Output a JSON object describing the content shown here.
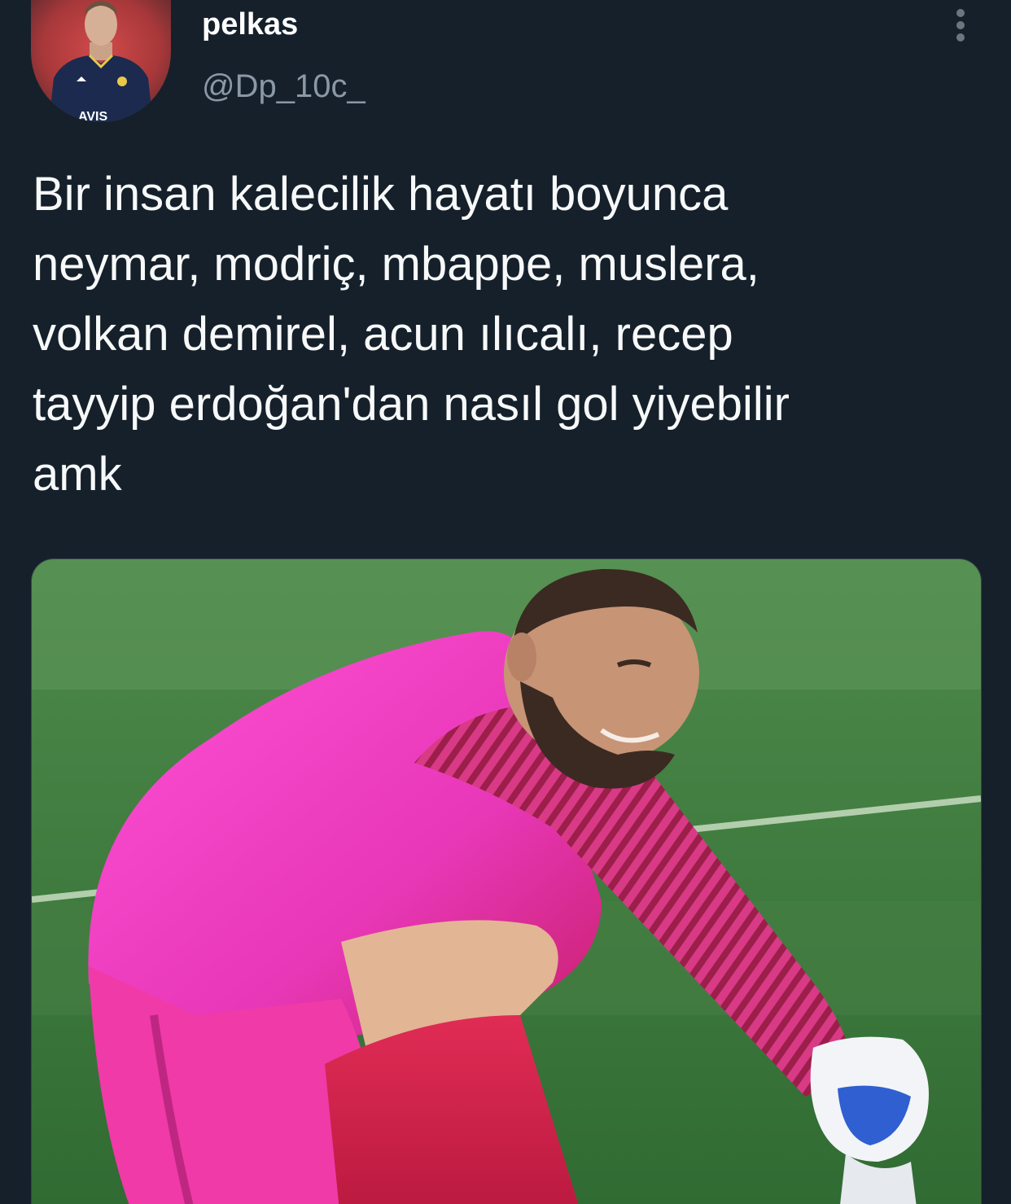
{
  "tweet": {
    "display_name": "pelkas",
    "handle": "@Dp_10c_",
    "text": "Bir insan kalecilik hayatı boyunca\nneymar, modriç, mbappe, muslera,\nvolkan demirel, acun ılıcalı, recep\ntayyip erdoğan'dan nasıl gol yiyebilir\namk",
    "avatar_jersey_text": "AVIS",
    "more_icon": "more-vertical-icon"
  },
  "colors": {
    "background": "#15202b",
    "text_primary": "#f7f9f9",
    "text_secondary": "#8b98a5",
    "border": "#38444d"
  }
}
